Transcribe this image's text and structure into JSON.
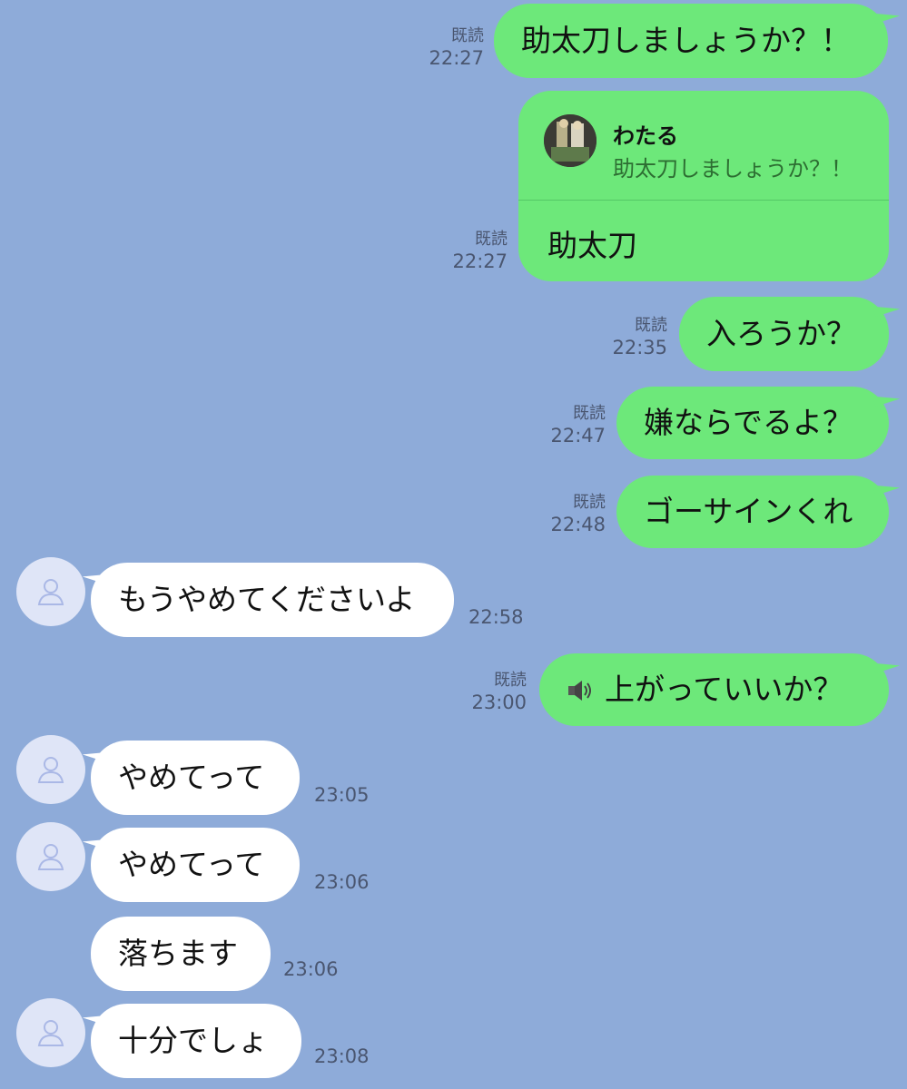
{
  "messages": [
    {
      "side": "out",
      "text": "助太刀しましょうか？！",
      "read": "既読",
      "time": "22:27"
    },
    {
      "side": "out",
      "type": "reply",
      "reply_name": "わたる",
      "reply_quote": "助太刀しましょうか？！",
      "text": "助太刀",
      "read": "既読",
      "time": "22:27"
    },
    {
      "side": "out",
      "text": "入ろうか？",
      "read": "既読",
      "time": "22:35"
    },
    {
      "side": "out",
      "text": "嫌ならでるよ？",
      "read": "既読",
      "time": "22:47"
    },
    {
      "side": "out",
      "text": "ゴーサインくれ",
      "read": "既読",
      "time": "22:48"
    },
    {
      "side": "in",
      "text": "もうやめてくださいよ",
      "time": "22:58"
    },
    {
      "side": "out",
      "text": "上がっていいか？",
      "icon": "speaker-icon",
      "read": "既読",
      "time": "23:00"
    },
    {
      "side": "in",
      "text": "やめてって",
      "time": "23:05"
    },
    {
      "side": "in",
      "text": "やめてって",
      "time": "23:06"
    },
    {
      "side": "in",
      "text": "落ちます",
      "time": "23:06"
    },
    {
      "side": "in",
      "text": "十分でしょ",
      "time": "23:08"
    }
  ],
  "colors": {
    "background": "#8eabd9",
    "outgoing_bubble": "#6de87a",
    "incoming_bubble": "#ffffff",
    "meta_text": "#4a5670"
  }
}
